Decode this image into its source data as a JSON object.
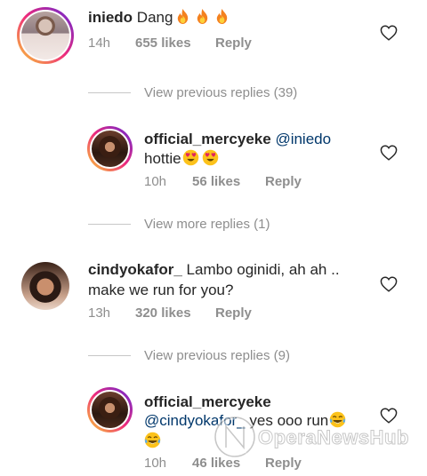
{
  "comments": [
    {
      "username": "iniedo",
      "text": "Dang",
      "emoji_suffix": [
        "fire-icon",
        "fire-icon",
        "fire-icon"
      ],
      "time": "14h",
      "likes": "655 likes",
      "reply_label": "Reply"
    },
    {
      "view_replies": "View previous replies (39)"
    },
    {
      "username": "official_mercyeke",
      "mention": "@iniedo",
      "text": "hottie",
      "emoji_suffix": [
        "heart-eyes-icon",
        "heart-eyes-icon"
      ],
      "time": "10h",
      "likes": "56 likes",
      "reply_label": "Reply"
    },
    {
      "view_replies": "View more replies (1)"
    },
    {
      "username": "cindyokafor_",
      "text_line1": "Lambo oginidi, ah ah ..",
      "text_line2": "make we run for you?",
      "time": "13h",
      "likes": "320 likes",
      "reply_label": "Reply"
    },
    {
      "view_replies": "View previous replies (9)"
    },
    {
      "username": "official_mercyeke",
      "mention": "@cindyokafor_",
      "text": "yes ooo run",
      "emoji_suffix": [
        "laughing-tears-icon",
        "laughing-tears-icon"
      ],
      "time": "10h",
      "likes": "46 likes",
      "reply_label": "Reply"
    }
  ],
  "watermark_text": "OperaNewsHub",
  "colors": {
    "text": "#262626",
    "muted": "#8e8e8e",
    "mention": "#00376b",
    "story_ring_start": "#f9ce34",
    "story_ring_end": "#6228d7"
  }
}
